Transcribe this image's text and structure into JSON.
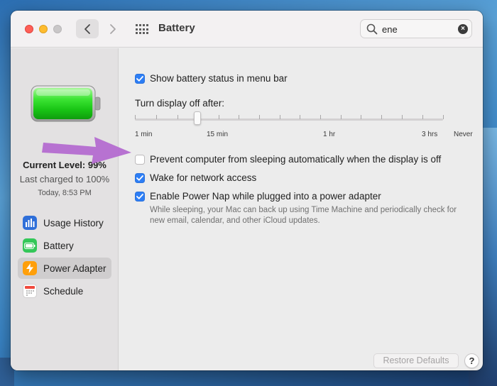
{
  "window": {
    "title": "Battery"
  },
  "toolbar": {
    "back_icon": "chevron-left-icon",
    "forward_icon": "chevron-right-icon",
    "grid_icon": "show-all-grid-icon"
  },
  "search": {
    "value": "ene",
    "clear_icon": "×"
  },
  "status": {
    "current_level": "Current Level: 99%",
    "charged": "Last charged to 100%",
    "time": "Today, 8:53 PM",
    "battery_fill": 0.99
  },
  "sidebar": {
    "items": [
      {
        "label": "Usage History",
        "icon": "bar-chart-icon",
        "color": "#2f6fd9"
      },
      {
        "label": "Battery",
        "icon": "battery-icon",
        "color": "#34c759"
      },
      {
        "label": "Power Adapter",
        "icon": "lightning-icon",
        "color": "#ff9f0a",
        "selected": true
      },
      {
        "label": "Schedule",
        "icon": "calendar-icon",
        "color": "#ffffff"
      }
    ]
  },
  "settings": {
    "show_status": {
      "label": "Show battery status in menu bar",
      "checked": true
    },
    "display_off": {
      "label": "Turn display off after:",
      "ticks": [
        "1 min",
        "15 min",
        "1 hr",
        "3 hrs",
        "Never"
      ],
      "selected_tick": "15 min"
    },
    "prevent_sleep": {
      "label": "Prevent computer from sleeping automatically when the display is off",
      "checked": false
    },
    "wake_network": {
      "label": "Wake for network access",
      "checked": true
    },
    "power_nap": {
      "label": "Enable Power Nap while plugged into a power adapter",
      "checked": true,
      "desc_line1": "While sleeping, your Mac can back up using Time Machine and periodically check for",
      "desc_line2": "new email, calendar, and other iCloud updates."
    }
  },
  "footer": {
    "restore_label": "Restore Defaults",
    "help_label": "?"
  },
  "colors": {
    "accent": "#2d7ef5",
    "annotation_arrow": "#b46bd0",
    "battery_green": "#22d31c"
  }
}
